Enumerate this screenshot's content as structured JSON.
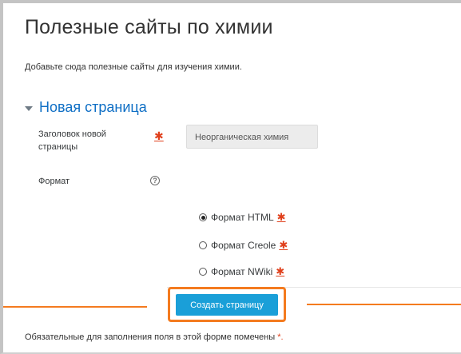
{
  "page": {
    "title": "Полезные сайты по химии",
    "intro": "Добавьте сюда полезные сайты для изучения химии."
  },
  "form": {
    "section_title": "Новая страница",
    "title_field": {
      "label": "Заголовок новой страницы",
      "value": "Неорганическая химия",
      "required_icon": "✱"
    },
    "format_field": {
      "label": "Формат",
      "help_icon": "?",
      "options": [
        {
          "label": "Формат HTML",
          "checked": true,
          "required_icon": "✱"
        },
        {
          "label": "Формат Creole",
          "checked": false,
          "required_icon": "✱"
        },
        {
          "label": "Формат NWiki",
          "checked": false,
          "required_icon": "✱"
        }
      ]
    },
    "submit_label": "Создать страницу",
    "required_note": "Обязательные для заполнения поля в этой форме помечены",
    "required_note_mark": "*."
  },
  "colors": {
    "accent_blue": "#1a9fd8",
    "section_blue": "#0f6fc5",
    "highlight_orange": "#f47b1f",
    "required_red": "#e0401c"
  }
}
